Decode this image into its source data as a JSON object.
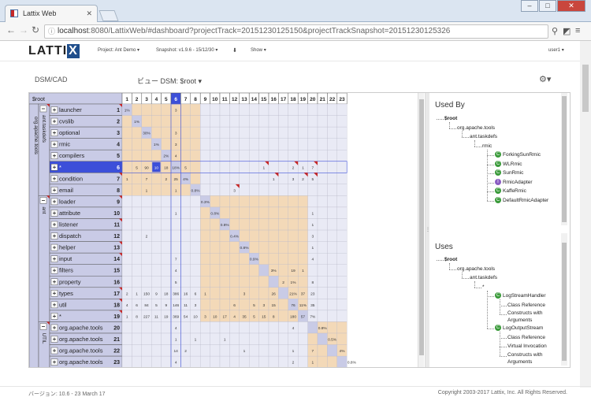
{
  "browser": {
    "tab_title": "Lattix Web",
    "url_host": "localhost",
    "url_rest": ":8080/LattixWeb/#dashboard?projectTrack=20151230125150&projectTrackSnapshot=20151230125326",
    "back_icon": "back-arrow-icon",
    "forward_icon": "forward-arrow-icon",
    "reload_icon": "reload-icon"
  },
  "app": {
    "logo_text": "LATTI",
    "logo_x": "X",
    "project_menu": "Project: Ant Demo",
    "snapshot_menu": "Snapshot: v1.9.6 - 15/12/30",
    "show_menu": "Show",
    "user_menu": "user1",
    "dsm_label": "DSM/CAD",
    "view_label": "ビュー DSM: $root"
  },
  "dsm": {
    "root_label": "$root",
    "outer_group": "org.apache.tools",
    "groups": [
      {
        "label": "ant.taskdefs",
        "start": 0,
        "end": 8
      },
      {
        "label": "ant",
        "start": 8,
        "end": 19
      },
      {
        "label": "UTIL",
        "start": 19,
        "end": 23
      }
    ],
    "rows": [
      {
        "label": "launcher",
        "idx": "1"
      },
      {
        "label": "cvslib",
        "idx": "2"
      },
      {
        "label": "optional",
        "idx": "3"
      },
      {
        "label": "rmic",
        "idx": "4"
      },
      {
        "label": "compilers",
        "idx": "5"
      },
      {
        "label": "*",
        "idx": "6"
      },
      {
        "label": "condition",
        "idx": "7"
      },
      {
        "label": "email",
        "idx": "8"
      },
      {
        "label": "loader",
        "idx": "9"
      },
      {
        "label": "attribute",
        "idx": "10"
      },
      {
        "label": "listener",
        "idx": "11"
      },
      {
        "label": "dispatch",
        "idx": "12"
      },
      {
        "label": "helper",
        "idx": "13"
      },
      {
        "label": "input",
        "idx": "14"
      },
      {
        "label": "filters",
        "idx": "15"
      },
      {
        "label": "property",
        "idx": "16"
      },
      {
        "label": "types",
        "idx": "17"
      },
      {
        "label": "util",
        "idx": "18"
      },
      {
        "label": "*",
        "idx": "19"
      },
      {
        "label": "org.apache.tools",
        "idx": "20"
      },
      {
        "label": "org.apache.tools",
        "idx": "21"
      },
      {
        "label": "org.apache.tools",
        "idx": "22"
      },
      {
        "label": "org.apache.tools",
        "idx": "23"
      }
    ],
    "col_headers": [
      "1",
      "2",
      "3",
      "4",
      "5",
      "6",
      "7",
      "8",
      "9",
      "10",
      "11",
      "12",
      "13",
      "14",
      "15",
      "16",
      "17",
      "18",
      "19",
      "20",
      "21",
      "22",
      "23"
    ],
    "selected_index": 5,
    "cells": [
      [
        0,
        0,
        "1%"
      ],
      [
        0,
        5,
        "3"
      ],
      [
        1,
        1,
        "1%"
      ],
      [
        2,
        2,
        "30%"
      ],
      [
        2,
        5,
        "3"
      ],
      [
        3,
        3,
        "1%"
      ],
      [
        3,
        5,
        "3"
      ],
      [
        4,
        4,
        "2%"
      ],
      [
        4,
        5,
        "4"
      ],
      [
        5,
        1,
        "5"
      ],
      [
        5,
        2,
        "90"
      ],
      [
        5,
        3,
        "10"
      ],
      [
        5,
        4,
        "18"
      ],
      [
        5,
        5,
        "18%"
      ],
      [
        5,
        6,
        "5"
      ],
      [
        5,
        14,
        "1"
      ],
      [
        5,
        17,
        "2"
      ],
      [
        5,
        18,
        "1"
      ],
      [
        5,
        19,
        "7"
      ],
      [
        6,
        0,
        "1"
      ],
      [
        6,
        2,
        "7"
      ],
      [
        6,
        4,
        "2"
      ],
      [
        6,
        5,
        "25"
      ],
      [
        6,
        6,
        "4%"
      ],
      [
        6,
        15,
        "1"
      ],
      [
        6,
        17,
        "3"
      ],
      [
        6,
        18,
        "2"
      ],
      [
        6,
        19,
        "5"
      ],
      [
        7,
        2,
        "1"
      ],
      [
        7,
        5,
        "1"
      ],
      [
        7,
        7,
        "0.8%"
      ],
      [
        7,
        11,
        "3"
      ],
      [
        8,
        8,
        "0.3%"
      ],
      [
        9,
        5,
        "1"
      ],
      [
        9,
        9,
        "0.8%"
      ],
      [
        9,
        19,
        "1"
      ],
      [
        10,
        10,
        "0.8%"
      ],
      [
        10,
        19,
        "1"
      ],
      [
        11,
        2,
        "2"
      ],
      [
        11,
        11,
        "0.4%"
      ],
      [
        11,
        19,
        "3"
      ],
      [
        12,
        12,
        "0.8%"
      ],
      [
        12,
        19,
        "1"
      ],
      [
        13,
        5,
        "7"
      ],
      [
        13,
        13,
        "0.9%"
      ],
      [
        13,
        19,
        "4"
      ],
      [
        14,
        5,
        "4"
      ],
      [
        14,
        15,
        "3%"
      ],
      [
        14,
        17,
        "19"
      ],
      [
        14,
        18,
        "1"
      ],
      [
        15,
        5,
        "5"
      ],
      [
        15,
        16,
        "2"
      ],
      [
        15,
        17,
        "1%"
      ],
      [
        15,
        19,
        "8"
      ],
      [
        16,
        0,
        "2"
      ],
      [
        16,
        1,
        "1"
      ],
      [
        16,
        2,
        "150"
      ],
      [
        16,
        3,
        "9"
      ],
      [
        16,
        4,
        "18"
      ],
      [
        16,
        5,
        "386"
      ],
      [
        16,
        6,
        "16"
      ],
      [
        16,
        7,
        "6"
      ],
      [
        16,
        8,
        "1"
      ],
      [
        16,
        12,
        "3"
      ],
      [
        16,
        15,
        "26"
      ],
      [
        16,
        17,
        "21%"
      ],
      [
        16,
        18,
        "37"
      ],
      [
        16,
        19,
        "23"
      ],
      [
        17,
        0,
        "4"
      ],
      [
        17,
        1,
        "6"
      ],
      [
        17,
        2,
        "84"
      ],
      [
        17,
        3,
        "5"
      ],
      [
        17,
        4,
        "9"
      ],
      [
        17,
        5,
        "146"
      ],
      [
        17,
        6,
        "11"
      ],
      [
        17,
        7,
        "3"
      ],
      [
        17,
        11,
        "6"
      ],
      [
        17,
        13,
        "5"
      ],
      [
        17,
        14,
        "3"
      ],
      [
        17,
        15,
        "15"
      ],
      [
        17,
        17,
        "76"
      ],
      [
        17,
        18,
        "11%"
      ],
      [
        17,
        19,
        "35"
      ],
      [
        18,
        0,
        "1"
      ],
      [
        18,
        1,
        "8"
      ],
      [
        18,
        2,
        "227"
      ],
      [
        18,
        3,
        "11"
      ],
      [
        18,
        4,
        "19"
      ],
      [
        18,
        5,
        "369"
      ],
      [
        18,
        6,
        "54"
      ],
      [
        18,
        7,
        "10"
      ],
      [
        18,
        8,
        "3"
      ],
      [
        18,
        9,
        "10"
      ],
      [
        18,
        10,
        "17"
      ],
      [
        18,
        11,
        "4"
      ],
      [
        18,
        12,
        "35"
      ],
      [
        18,
        13,
        "5"
      ],
      [
        18,
        14,
        "15"
      ],
      [
        18,
        15,
        "8"
      ],
      [
        18,
        17,
        "180"
      ],
      [
        18,
        18,
        "57"
      ],
      [
        18,
        19,
        "7%"
      ],
      [
        19,
        5,
        "4"
      ],
      [
        19,
        17,
        "4"
      ],
      [
        19,
        20,
        "0.8%"
      ],
      [
        20,
        5,
        "1"
      ],
      [
        20,
        7,
        "1"
      ],
      [
        20,
        10,
        "1"
      ],
      [
        20,
        21,
        "0.5%"
      ],
      [
        21,
        5,
        "14"
      ],
      [
        21,
        6,
        "2"
      ],
      [
        21,
        12,
        "1"
      ],
      [
        21,
        17,
        "1"
      ],
      [
        21,
        19,
        "7"
      ],
      [
        21,
        22,
        "4%"
      ],
      [
        22,
        5,
        "4"
      ],
      [
        22,
        17,
        "2"
      ],
      [
        22,
        19,
        "1"
      ],
      [
        22,
        23,
        "0.8%"
      ]
    ],
    "markers": [
      [
        5,
        14
      ],
      [
        5,
        17
      ],
      [
        5,
        19
      ],
      [
        6,
        15
      ],
      [
        6,
        18
      ],
      [
        6,
        19
      ],
      [
        7,
        11
      ],
      [
        13,
        0
      ],
      [
        16,
        0
      ],
      [
        17,
        0
      ],
      [
        18,
        0
      ],
      [
        8,
        0
      ],
      [
        10,
        0
      ],
      [
        12,
        0
      ],
      [
        0,
        0
      ],
      [
        6,
        0
      ]
    ]
  },
  "used_by": {
    "title": "Used By",
    "nodes": [
      {
        "label": "$root",
        "depth": 0,
        "kind": "folder",
        "bold": true
      },
      {
        "label": "org.apache.tools",
        "depth": 1,
        "kind": "folder"
      },
      {
        "label": "ant.taskdefs",
        "depth": 2,
        "kind": "folder"
      },
      {
        "label": "rmic",
        "depth": 3,
        "kind": "folder"
      },
      {
        "label": "ForkingSunRmic",
        "depth": 4,
        "kind": "class"
      },
      {
        "label": "WLRmic",
        "depth": 4,
        "kind": "class"
      },
      {
        "label": "SunRmic",
        "depth": 4,
        "kind": "class"
      },
      {
        "label": "RmicAdapter",
        "depth": 4,
        "kind": "interface"
      },
      {
        "label": "KaffeRmic",
        "depth": 4,
        "kind": "class"
      },
      {
        "label": "DefaultRmicAdapter",
        "depth": 4,
        "kind": "class"
      }
    ]
  },
  "uses": {
    "title": "Uses",
    "nodes": [
      {
        "label": "$root",
        "depth": 0,
        "kind": "folder",
        "bold": true
      },
      {
        "label": "org.apache.tools",
        "depth": 1,
        "kind": "folder"
      },
      {
        "label": "ant.taskdefs",
        "depth": 2,
        "kind": "folder"
      },
      {
        "label": "*",
        "depth": 3,
        "kind": "folder"
      },
      {
        "label": "LogStreamHandler",
        "depth": 4,
        "kind": "class"
      },
      {
        "label": "Class Reference",
        "depth": 5,
        "kind": "leaf"
      },
      {
        "label": "Constructs with Arguments",
        "depth": 5,
        "kind": "leaf",
        "two_line": true
      },
      {
        "label": "LogOutputStream",
        "depth": 4,
        "kind": "class"
      },
      {
        "label": "Class Reference",
        "depth": 5,
        "kind": "leaf"
      },
      {
        "label": "Virtual Invocation",
        "depth": 5,
        "kind": "leaf"
      },
      {
        "label": "Constructs with Arguments",
        "depth": 5,
        "kind": "leaf",
        "two_line": true
      }
    ]
  },
  "footer": {
    "version": "バージョン: 10.6 - 23 March 17",
    "copyright": "Copyright 2003-2017 Lattix, Inc. All Rights Reserved."
  },
  "colors": {
    "accent": "#1f4e8c",
    "selected": "#3c4fd9",
    "lavender": "#c9cbe6",
    "tan": "#f3d9b8",
    "marker": "#c62828",
    "grid": "#e9eaf5"
  }
}
